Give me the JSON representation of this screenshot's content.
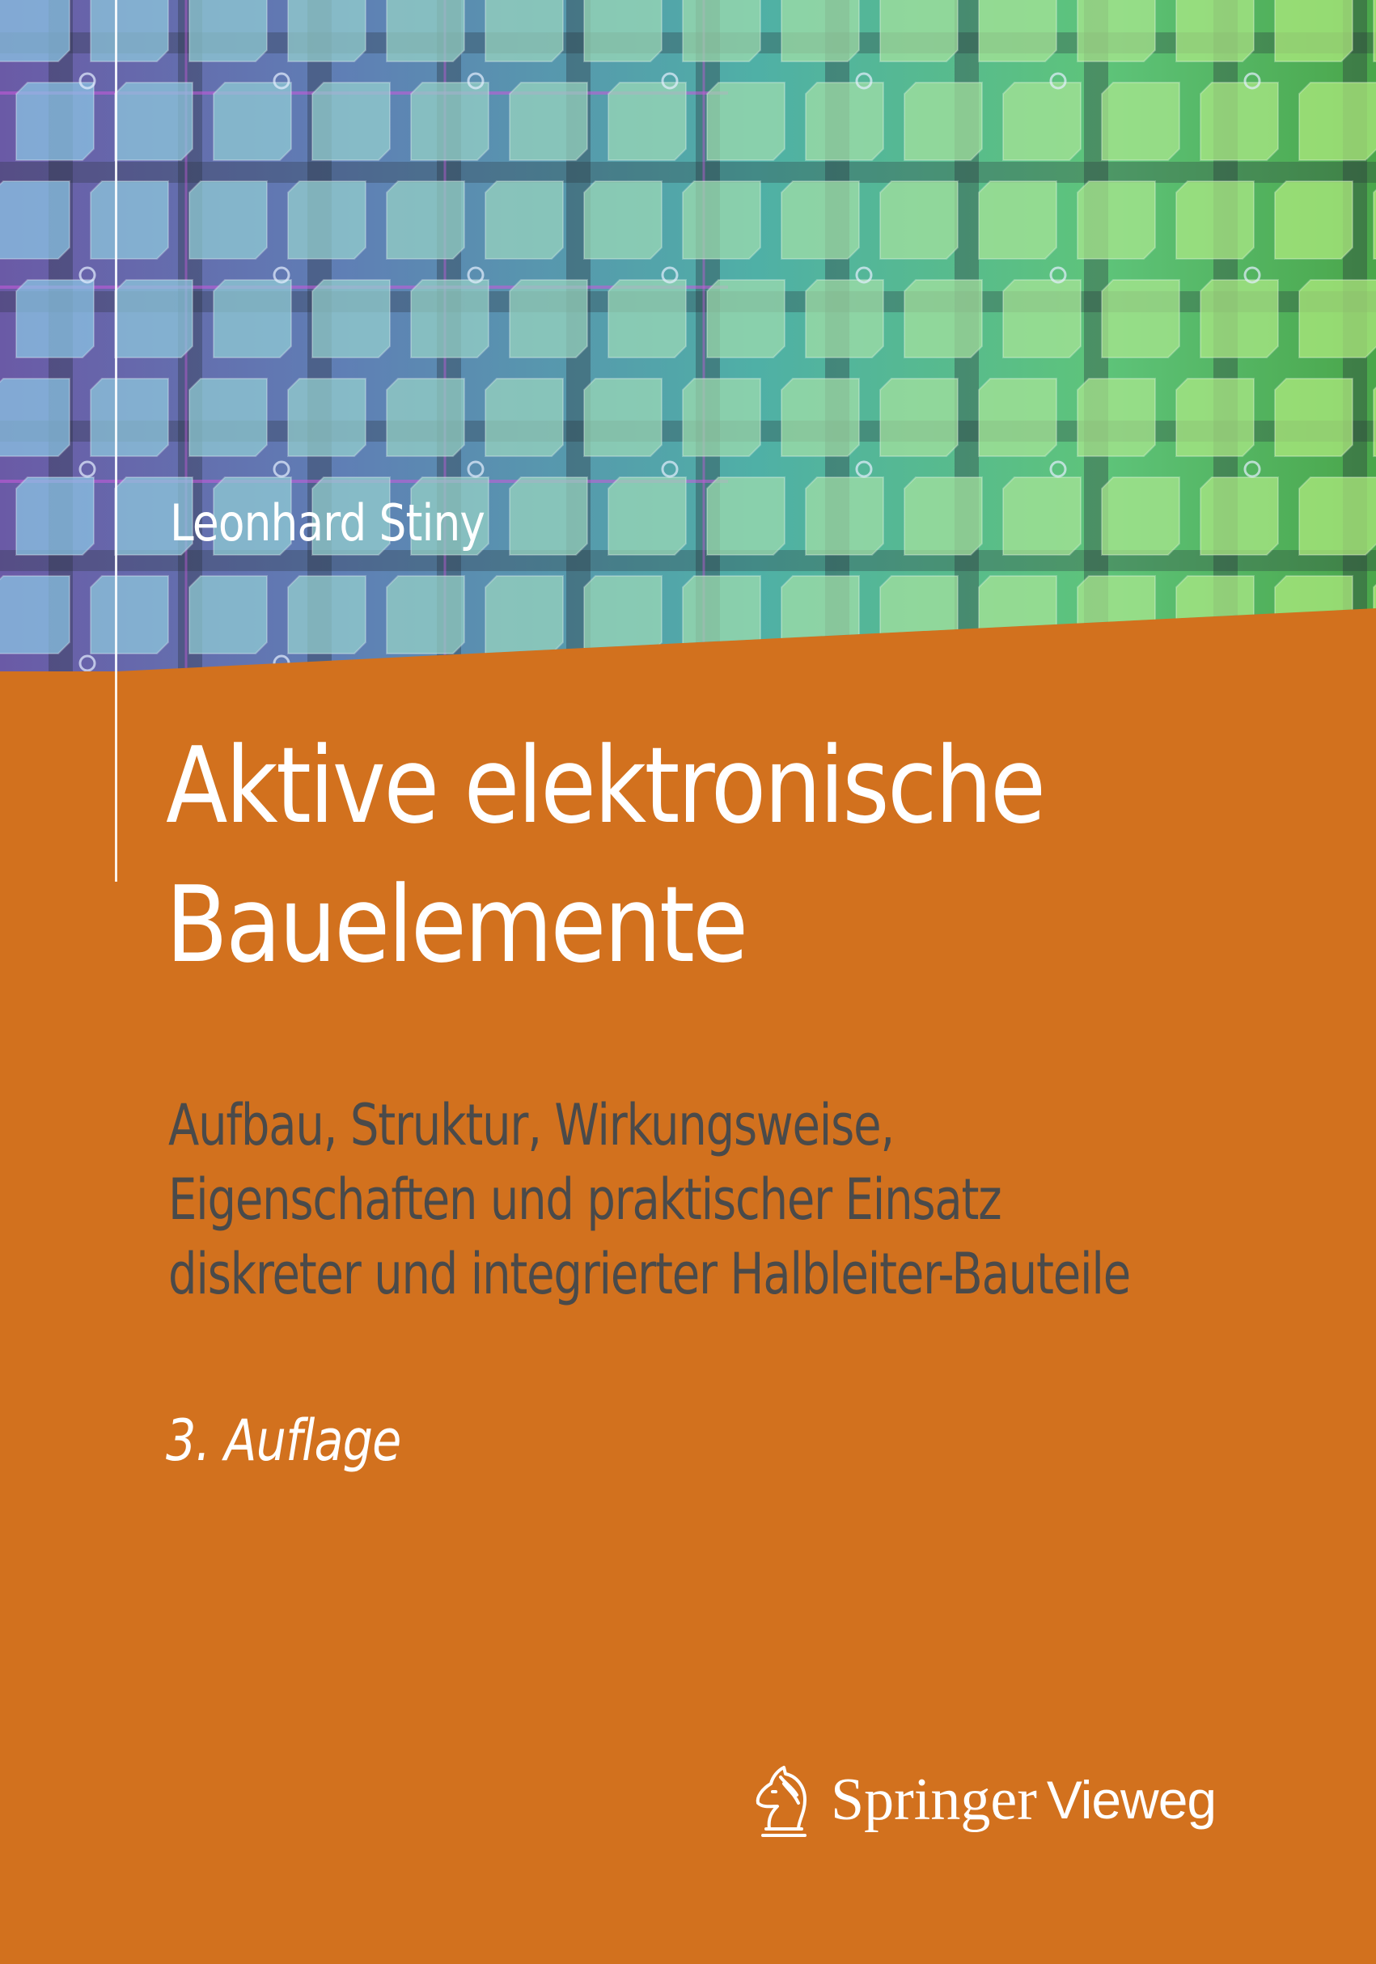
{
  "cover": {
    "author": "Leonhard Stiny",
    "title_lines": [
      "Aktive elektronische",
      "Bauelemente"
    ],
    "subtitle_lines": [
      "Aufbau, Struktur, Wirkungsweise,",
      "Eigenschaften und praktischer Einsatz",
      "diskreter und integrierter Halbleiter-Bauteile"
    ],
    "edition": "3. Auflage",
    "publisher": {
      "name": "Springer",
      "imprint": "Vieweg",
      "logo_icon": "knight-chess-piece-icon"
    }
  },
  "colors": {
    "background": "#d2711e",
    "title_text": "#ffffff",
    "subtitle_text": "#4a4a4a"
  }
}
